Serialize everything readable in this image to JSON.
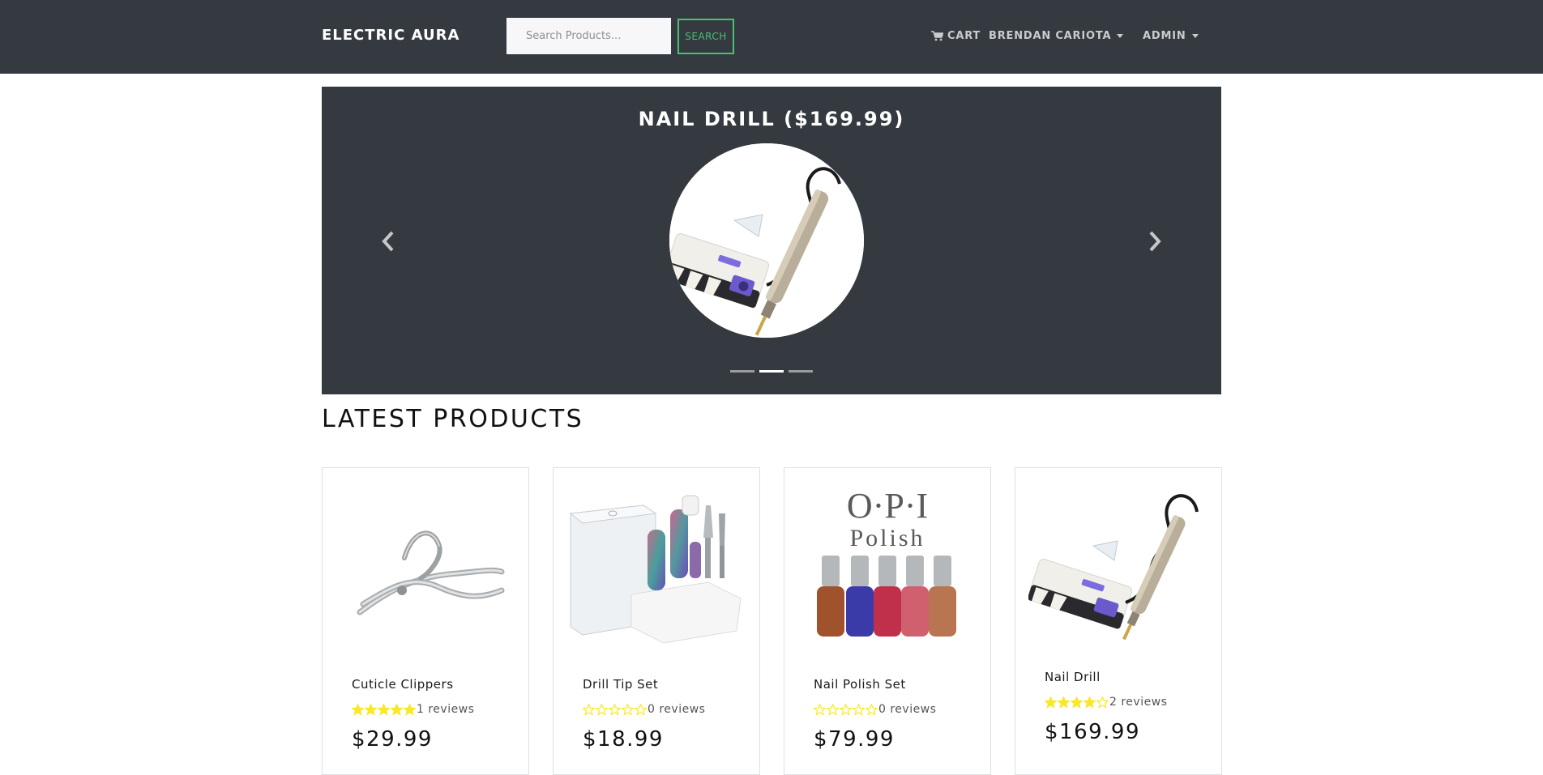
{
  "navbar": {
    "brand": "ELECTRIC AURA",
    "search_placeholder": "Search Products...",
    "search_button": "SEARCH",
    "cart_label": "CART",
    "cart_icon": "shopping-cart-icon",
    "user_label": "BRENDAN CARIOTA",
    "admin_label": "ADMIN"
  },
  "carousel": {
    "caption": "NAIL DRILL ($169.99)",
    "image": "nail-drill-image",
    "prev_icon": "chevron-left-icon",
    "next_icon": "chevron-right-icon",
    "indicators": 3,
    "active_indicator": 2
  },
  "section_title": "LATEST PRODUCTS",
  "products": [
    {
      "name": "Cuticle Clippers",
      "rating": 5,
      "reviews": "1 reviews",
      "price": "$29.99",
      "image": "cuticle-clippers-image"
    },
    {
      "name": "Drill Tip Set",
      "rating": 0,
      "reviews": "0 reviews",
      "price": "$18.99",
      "image": "drill-tip-set-image"
    },
    {
      "name": "Nail Polish Set",
      "rating": 0,
      "reviews": "0 reviews",
      "price": "$79.99",
      "image": "nail-polish-set-image",
      "logo_text": "O·P·I",
      "logo_sub": "Polish"
    },
    {
      "name": "Nail Drill",
      "rating": 4,
      "reviews": "2 reviews",
      "price": "$169.99",
      "image": "nail-drill-image"
    }
  ],
  "colors": {
    "navbar_bg": "#343a40",
    "accent_green": "#4bbf73",
    "star_yellow": "#f8e825"
  }
}
